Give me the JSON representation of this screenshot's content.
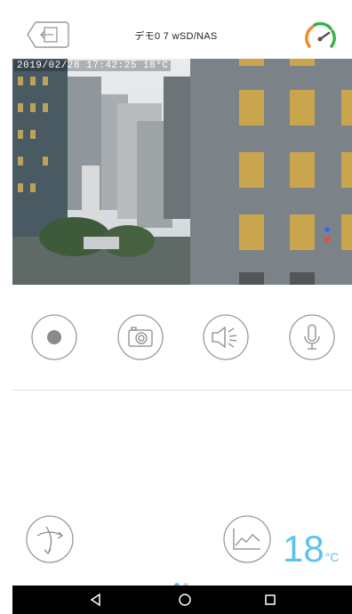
{
  "header": {
    "title": "デモ0 7 wSD/NAS"
  },
  "video": {
    "timestamp": "2019/02/28 17:42:25 18°C"
  },
  "controls": [
    {
      "name": "record-button",
      "icon": "record-icon"
    },
    {
      "name": "snapshot-button",
      "icon": "camera-icon"
    },
    {
      "name": "speaker-button",
      "icon": "speaker-icon"
    },
    {
      "name": "microphone-button",
      "icon": "microphone-icon"
    }
  ],
  "temperature": {
    "value": "18",
    "unit": "°C"
  },
  "pager": {
    "pages": 2,
    "active": 0
  },
  "colors": {
    "accent": "#5cc4ea",
    "icon": "#9a9a9a",
    "navbar": "#000000",
    "gauge_green": "#37b24d",
    "gauge_orange": "#f08c2b"
  },
  "navbar": {
    "buttons": [
      "back-triangle-icon",
      "home-circle-icon",
      "recents-square-icon"
    ]
  }
}
